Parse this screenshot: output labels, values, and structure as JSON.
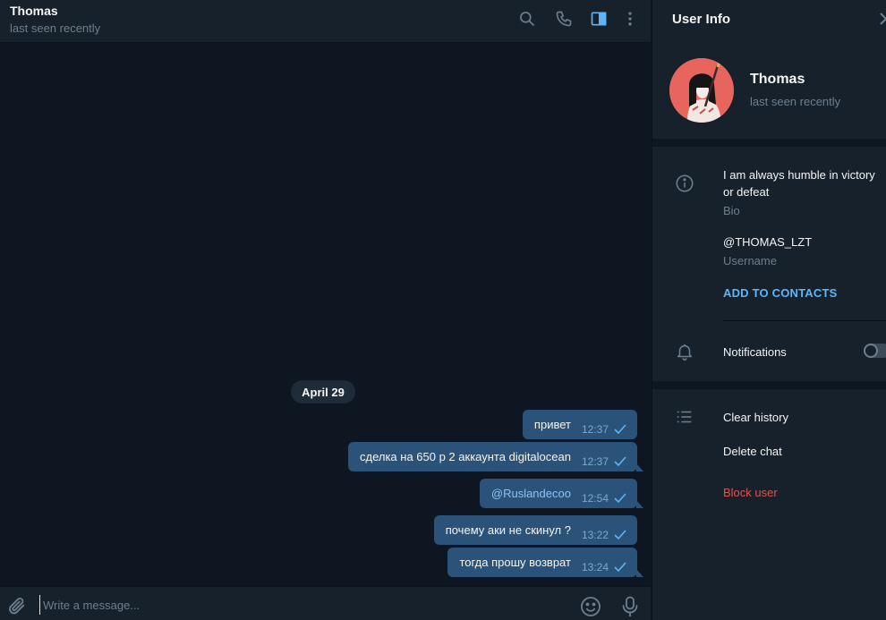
{
  "header": {
    "title": "Thomas",
    "status": "last seen recently"
  },
  "messages": {
    "date": "April 29",
    "items": [
      {
        "text": "привет",
        "time": "12:37",
        "link": false
      },
      {
        "text": "сделка на 650 р 2 аккаунта digitalocean",
        "time": "12:37",
        "link": false
      },
      {
        "text": "@Ruslandecoo",
        "time": "12:54",
        "link": true
      },
      {
        "text": "почему аки не скинул ?",
        "time": "13:22",
        "link": false
      },
      {
        "text": "тогда прошу возврат",
        "time": "13:24",
        "link": false
      }
    ]
  },
  "composer": {
    "placeholder": "Write a message..."
  },
  "panel": {
    "title": "User Info",
    "name": "Thomas",
    "status": "last seen recently",
    "bio": "I am always humble in victory or defeat",
    "bio_label": "Bio",
    "username": "@THOMAS_LZT",
    "username_label": "Username",
    "add_contact": "ADD TO CONTACTS",
    "notifications": "Notifications",
    "notifications_enabled": false,
    "clear_history": "Clear history",
    "delete_chat": "Delete chat",
    "block_user": "Block user"
  },
  "colors": {
    "background": "#0e1621",
    "panel": "#17212b",
    "bubble_out": "#2b5278",
    "accent": "#5eb5f7",
    "danger": "#e5504f",
    "muted": "#6d7f8f"
  },
  "icons": [
    "search-icon",
    "phone-icon",
    "sidebar-toggle-icon",
    "more-vertical-icon",
    "paperclip-icon",
    "emoji-icon",
    "microphone-icon",
    "close-icon",
    "info-icon",
    "bell-icon",
    "list-icon",
    "check-icon"
  ]
}
